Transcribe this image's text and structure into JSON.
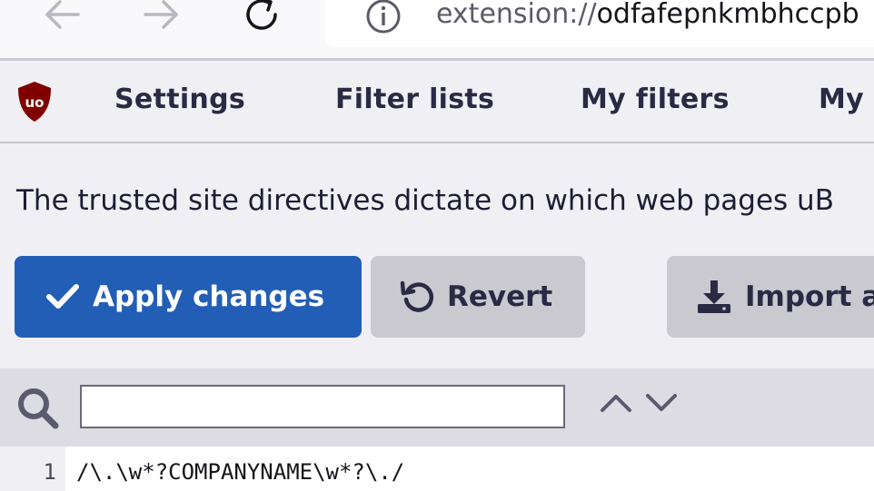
{
  "browser": {
    "url_scheme": "extension://",
    "url_rest": "odfafepnkmbhccpb",
    "icons": [
      "back-arrow-icon",
      "forward-arrow-icon",
      "reload-icon",
      "info-icon"
    ]
  },
  "nav": {
    "logo_text": "uo",
    "tabs": [
      {
        "label": "Settings"
      },
      {
        "label": "Filter lists"
      },
      {
        "label": "My filters"
      },
      {
        "label": "My"
      }
    ]
  },
  "content": {
    "description": "The trusted site directives dictate on which web pages uB"
  },
  "buttons": {
    "apply_label": "Apply changes",
    "revert_label": "Revert",
    "import_label": "Import a"
  },
  "search": {
    "value": ""
  },
  "editor": {
    "lines": [
      {
        "number": "1",
        "text": "/\\.\\w*?COMPANYNAME\\w*?\\./"
      }
    ]
  },
  "colors": {
    "accent": "#225eb6",
    "logo_red": "#800000",
    "text": "#2b2a45",
    "button_grey": "#c9c9cf"
  }
}
